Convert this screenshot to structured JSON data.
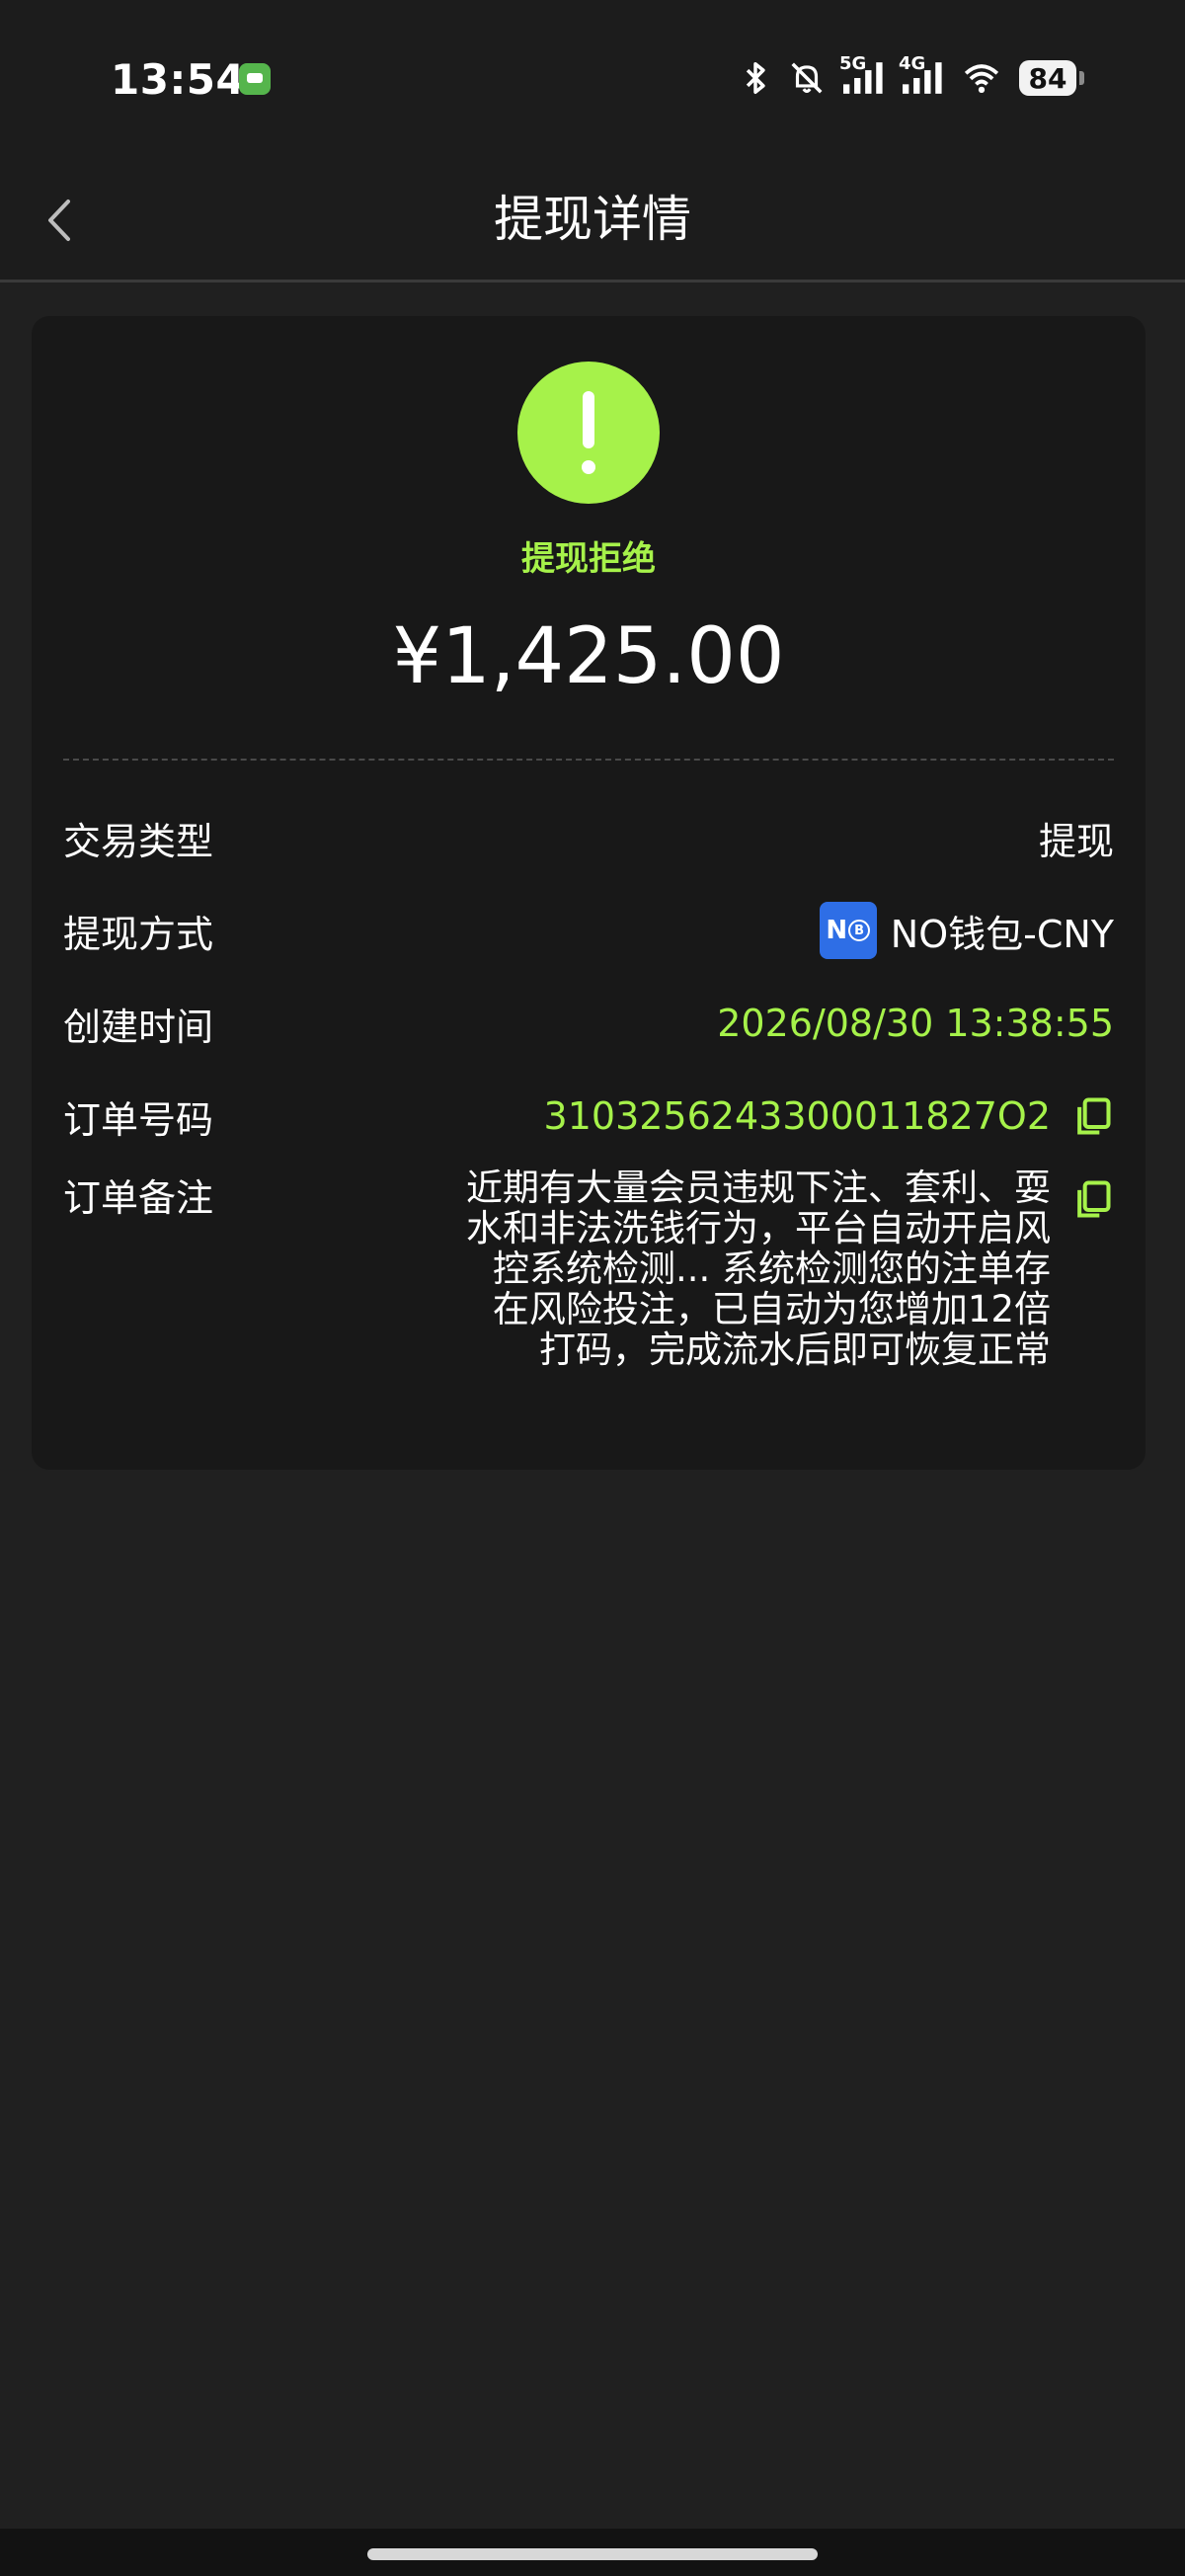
{
  "status_bar": {
    "time": "13:54",
    "icons": [
      "app-notification-icon",
      "bluetooth-icon",
      "bell-off-icon",
      "signal-5g-icon",
      "signal-4g-icon",
      "wifi-icon"
    ],
    "network_labels": [
      "5G",
      "4G"
    ],
    "battery": "84"
  },
  "header": {
    "back_icon": "chevron-left-icon",
    "title": "提现详情"
  },
  "card": {
    "status_icon": "exclamation-icon",
    "status_color": "#a6f24a",
    "status_text": "提现拒绝",
    "amount": "¥1,425.00",
    "rows": [
      {
        "label": "交易类型",
        "value": "提现"
      },
      {
        "label": "提现方式",
        "value": "NO钱包-CNY",
        "logo_text": "N",
        "logo_coin": "B"
      },
      {
        "label": "创建时间",
        "value": "2026/08/30 13:38:55"
      },
      {
        "label": "订单号码",
        "value": "3103256243300011827O2"
      }
    ],
    "note": {
      "label": "订单备注",
      "text": "近期有大量会员违规下注、套利、耍水和非法洗钱行为，平台自动开启风控系统检测... 系统检测您的注单存在风险投注，已自动为您增加12倍打码，完成流水后即可恢复正常"
    },
    "copy_icon": "copy-icon"
  }
}
